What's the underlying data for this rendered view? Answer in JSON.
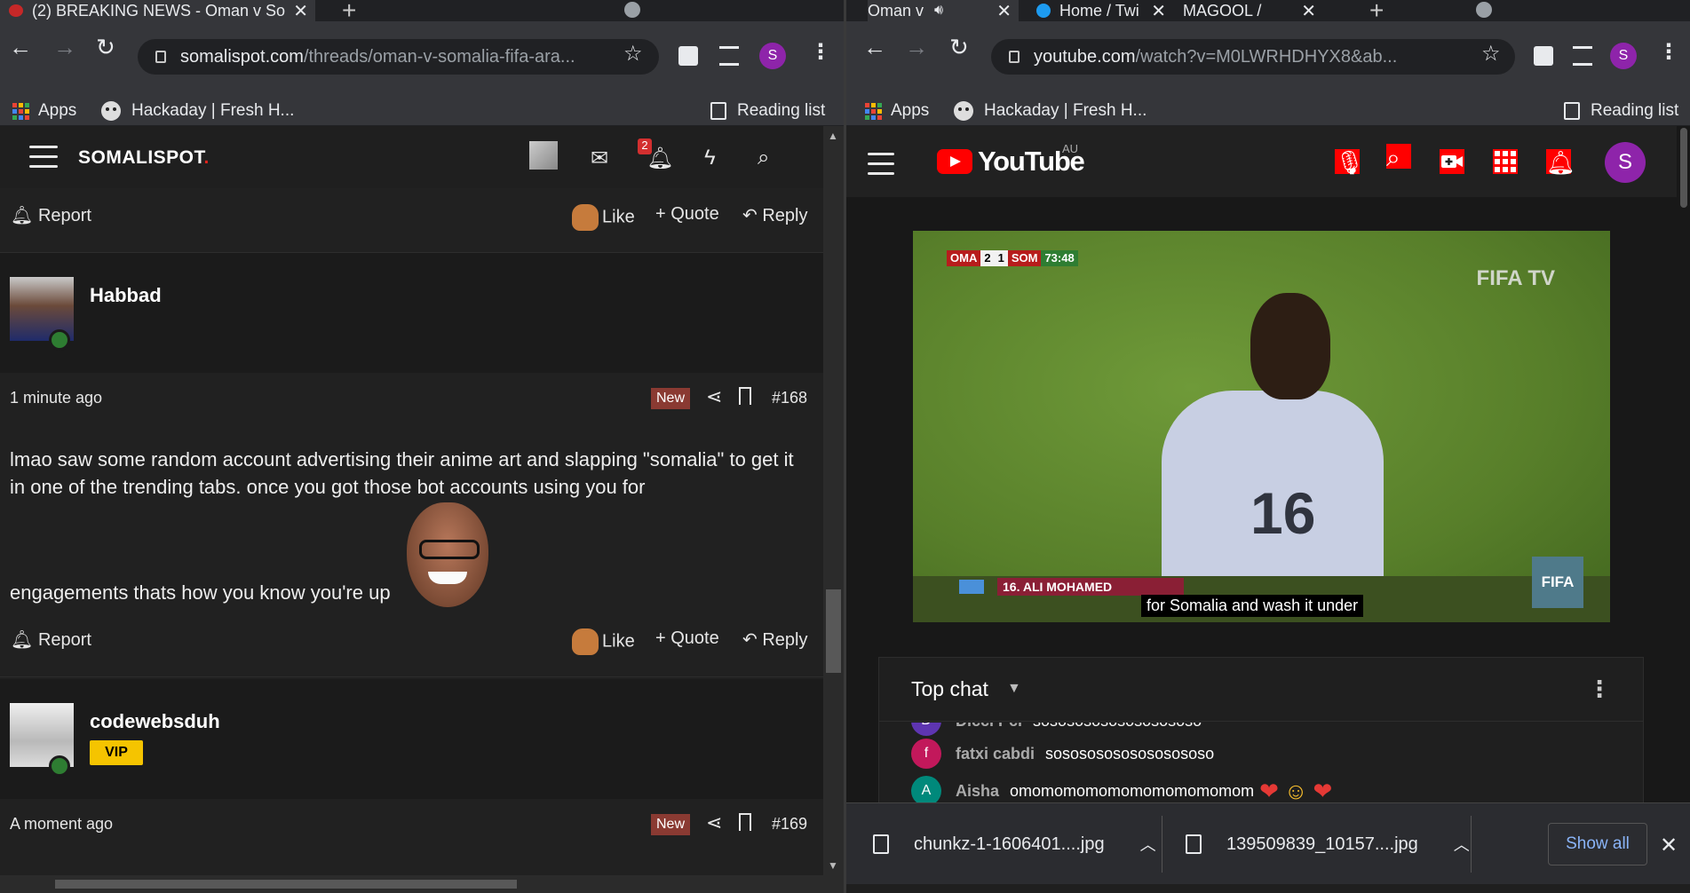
{
  "left": {
    "tabs": [
      {
        "title": "(2) BREAKING NEWS - Oman v So",
        "active": true
      }
    ],
    "address": {
      "host": "somalispot.com",
      "path": "/threads/oman-v-somalia-fifa-ara..."
    },
    "profile_initial": "S",
    "bookmarks": {
      "apps": "Apps",
      "hackaday": "Hackaday | Fresh H...",
      "reading_list": "Reading list"
    },
    "site": {
      "logo": "SOMALISPOT",
      "logo_dot": ".",
      "alerts_count": "2"
    },
    "actions": {
      "report": "Report",
      "like": "Like",
      "quote": "Quote",
      "reply": "Reply"
    },
    "posts": [
      {
        "author": "Habbad",
        "time": "1 minute ago",
        "badge": "New",
        "number": "#168",
        "text_line1": "lmao saw some random account advertising their anime art and slapping \"somalia\" to get it in one of the trending tabs. once you got those bot accounts using you for",
        "text_line2": "engagements thats how you know you're up"
      },
      {
        "author": "codewebsduh",
        "role": "VIP",
        "time": "A moment ago",
        "badge": "New",
        "number": "#169"
      }
    ]
  },
  "right": {
    "tabs": [
      {
        "title": "Oman v",
        "active": true
      },
      {
        "title": "Home / Twi",
        "active": false
      },
      {
        "title": "MAGOOL /",
        "active": false
      }
    ],
    "address": {
      "host": "youtube.com",
      "path": "/watch?v=M0LWRHDHYX8&ab..."
    },
    "profile_initial": "S",
    "bookmarks": {
      "apps": "Apps",
      "hackaday": "Hackaday | Fresh H...",
      "reading_list": "Reading list"
    },
    "youtube": {
      "logo_text": "YouTube",
      "region": "AU",
      "avatar_initial": "S"
    },
    "video": {
      "team1": "OMA",
      "score1": "2",
      "score2": "1",
      "team2": "SOM",
      "clock": "73:48",
      "watermark": "FIFA TV",
      "shirt_number": "16",
      "lower_third": "16. ALI MOHAMED",
      "caption": "for Somalia and wash it under",
      "corner_logo": "FIFA"
    },
    "chat": {
      "title": "Top chat",
      "messages": [
        {
          "initial": "D",
          "name": "Dicci Pci",
          "message": "sosososososososososo",
          "color": "#5e35b1"
        },
        {
          "initial": "f",
          "name": "fatxi cabdi",
          "message": "sosososososososososo",
          "color": "#c2185b"
        },
        {
          "initial": "A",
          "name": "Aisha",
          "message": "omomomomomomomomomomom",
          "color": "#00897b"
        }
      ]
    },
    "downloads": [
      {
        "name": "chunkz-1-1606401....jpg"
      },
      {
        "name": "139509839_10157....jpg"
      }
    ],
    "show_all": "Show all"
  }
}
